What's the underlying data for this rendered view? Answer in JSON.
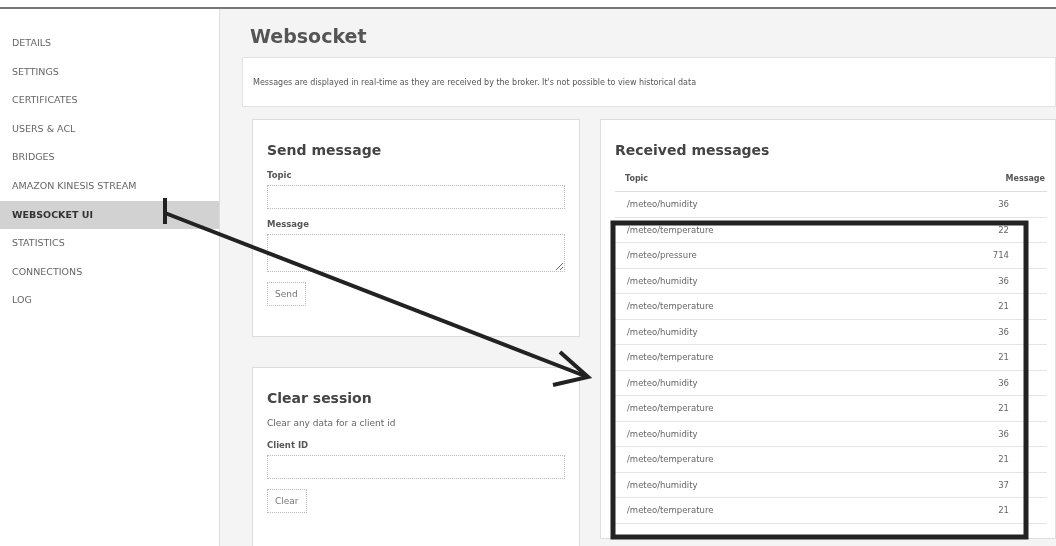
{
  "sidebar": {
    "items": [
      {
        "label": "DETAILS",
        "selected": false
      },
      {
        "label": "SETTINGS",
        "selected": false
      },
      {
        "label": "CERTIFICATES",
        "selected": false
      },
      {
        "label": "USERS & ACL",
        "selected": false
      },
      {
        "label": "BRIDGES",
        "selected": false
      },
      {
        "label": "AMAZON KINESIS STREAM",
        "selected": false
      },
      {
        "label": "WEBSOCKET UI",
        "selected": true
      },
      {
        "label": "STATISTICS",
        "selected": false
      },
      {
        "label": "CONNECTIONS",
        "selected": false
      },
      {
        "label": "LOG",
        "selected": false
      }
    ]
  },
  "page_title": "Websocket",
  "notice": "Messages are displayed in real-time as they are received by the broker. It's not possible to view historical data",
  "send_message": {
    "title": "Send message",
    "topic_label": "Topic",
    "message_label": "Message",
    "button": "Send"
  },
  "clear_session": {
    "title": "Clear session",
    "description": "Clear any data for a client id",
    "client_id_label": "Client ID",
    "button": "Clear"
  },
  "received_messages": {
    "title": "Received messages",
    "columns": [
      "Topic",
      "Message"
    ],
    "rows": [
      {
        "topic": "/meteo/humidity",
        "message": "36"
      },
      {
        "topic": "/meteo/temperature",
        "message": "22"
      },
      {
        "topic": "/meteo/pressure",
        "message": "714"
      },
      {
        "topic": "/meteo/humidity",
        "message": "36"
      },
      {
        "topic": "/meteo/temperature",
        "message": "21"
      },
      {
        "topic": "/meteo/humidity",
        "message": "36"
      },
      {
        "topic": "/meteo/temperature",
        "message": "21"
      },
      {
        "topic": "/meteo/humidity",
        "message": "36"
      },
      {
        "topic": "/meteo/temperature",
        "message": "21"
      },
      {
        "topic": "/meteo/humidity",
        "message": "36"
      },
      {
        "topic": "/meteo/temperature",
        "message": "21"
      },
      {
        "topic": "/meteo/humidity",
        "message": "37"
      },
      {
        "topic": "/meteo/temperature",
        "message": "21"
      }
    ]
  }
}
